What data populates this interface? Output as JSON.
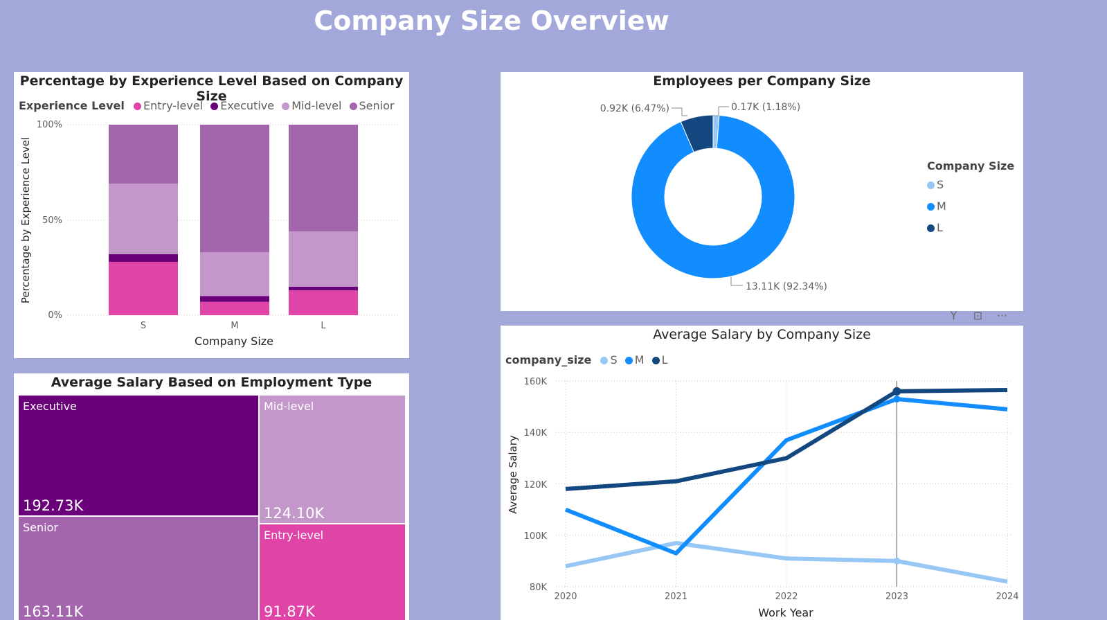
{
  "page": {
    "title": "Company Size Overview"
  },
  "experience_chart": {
    "title": "Percentage by Experience Level Based on Company Size",
    "legend_title": "Experience Level",
    "legend": [
      {
        "name": "Entry-level",
        "color": "#e044a7"
      },
      {
        "name": "Executive",
        "color": "#6b007b"
      },
      {
        "name": "Mid-level",
        "color": "#c397ca"
      },
      {
        "name": "Senior",
        "color": "#a366ad"
      }
    ],
    "y_ticks": [
      "100%",
      "50%",
      "0%"
    ],
    "ylabel": "Percentage by Experience Level",
    "xlabel": "Company Size"
  },
  "donut": {
    "title": "Employees per Company Size",
    "legend_title": "Company Size",
    "legend": [
      {
        "name": "S",
        "color": "#97c7f5"
      },
      {
        "name": "M",
        "color": "#118dff"
      },
      {
        "name": "L",
        "color": "#12487f"
      }
    ],
    "labels": {
      "l": "0.92K (6.47%)",
      "s": "0.17K (1.18%)",
      "m": "13.11K (92.34%)"
    }
  },
  "treemap": {
    "title": "Average Salary Based on Employment Type",
    "items": [
      {
        "name": "Executive",
        "value": "192.73K",
        "color": "#6b007b"
      },
      {
        "name": "Mid-level",
        "value": "124.10K",
        "color": "#c397ca"
      },
      {
        "name": "Senior",
        "value": "163.11K",
        "color": "#a366ad"
      },
      {
        "name": "Entry-level",
        "value": "91.87K",
        "color": "#e044a7"
      }
    ]
  },
  "salary_chart": {
    "title": "Average Salary by Company Size",
    "legend_title": "company_size",
    "legend": [
      {
        "name": "S",
        "color": "#97c7f5"
      },
      {
        "name": "M",
        "color": "#118dff"
      },
      {
        "name": "L",
        "color": "#12487f"
      }
    ],
    "ylabel": "Average Salary",
    "xlabel": "Work Year",
    "y_ticks": [
      "160K",
      "140K",
      "120K",
      "100K",
      "80K"
    ]
  },
  "toolbar": {
    "filter_icon": "Y",
    "focus_icon": "⊡",
    "more_icon": "···"
  },
  "chart_data": [
    {
      "type": "bar",
      "stacked": "100%",
      "title": "Percentage by Experience Level Based on Company Size",
      "xlabel": "Company Size",
      "ylabel": "Percentage by Experience Level",
      "categories": [
        "S",
        "M",
        "L"
      ],
      "ylim": [
        0,
        100
      ],
      "series": [
        {
          "name": "Entry-level",
          "values": [
            28,
            7,
            13
          ]
        },
        {
          "name": "Executive",
          "values": [
            4,
            3,
            2
          ]
        },
        {
          "name": "Mid-level",
          "values": [
            37,
            23,
            29
          ]
        },
        {
          "name": "Senior",
          "values": [
            31,
            67,
            56
          ]
        }
      ],
      "legend_position": "top-left",
      "grid": true
    },
    {
      "type": "pie",
      "donut": true,
      "title": "Employees per Company Size",
      "categories": [
        "S",
        "M",
        "L"
      ],
      "values": [
        0.17,
        13.11,
        0.92
      ],
      "percentages": [
        1.18,
        92.34,
        6.47
      ]
    },
    {
      "type": "treemap",
      "title": "Average Salary Based on Employment Type",
      "categories": [
        "Executive",
        "Senior",
        "Mid-level",
        "Entry-level"
      ],
      "values": [
        192.73,
        163.11,
        124.1,
        91.87
      ]
    },
    {
      "type": "line",
      "title": "Average Salary by Company Size",
      "xlabel": "Work Year",
      "ylabel": "Average Salary",
      "x": [
        2020,
        2021,
        2022,
        2023,
        2024
      ],
      "ylim": [
        80000,
        160000
      ],
      "series": [
        {
          "name": "S",
          "values": [
            88000,
            97000,
            91000,
            90000,
            82000
          ]
        },
        {
          "name": "M",
          "values": [
            110000,
            93000,
            137000,
            153000,
            149000
          ]
        },
        {
          "name": "L",
          "values": [
            118000,
            121000,
            130000,
            156000,
            156500
          ]
        }
      ],
      "legend_position": "top-left",
      "grid": true
    }
  ]
}
